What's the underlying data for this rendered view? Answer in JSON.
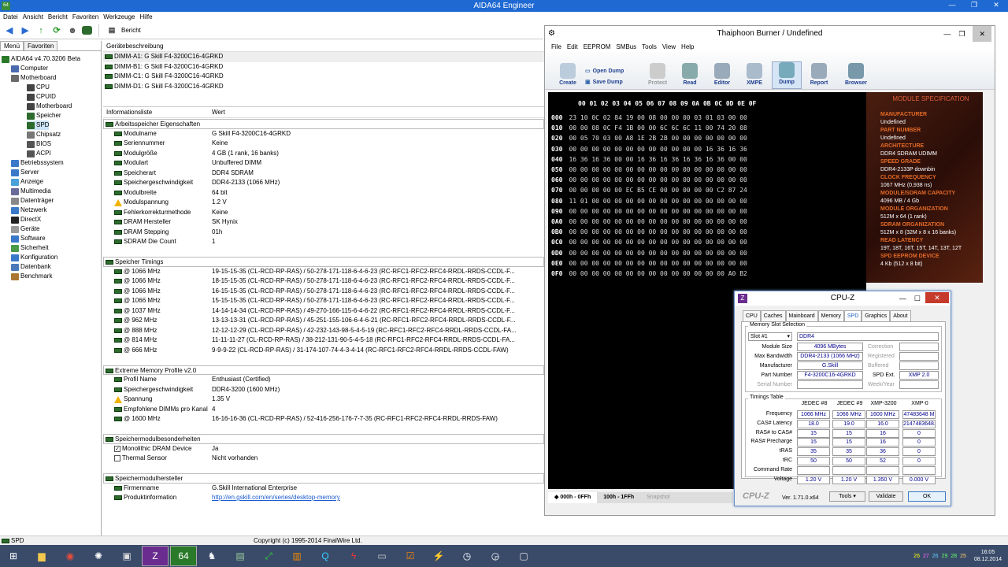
{
  "main_window": {
    "title": "AIDA64 Engineer",
    "menu": [
      "Datei",
      "Ansicht",
      "Bericht",
      "Favoriten",
      "Werkzeuge",
      "Hilfe"
    ],
    "toolbar_report_label": "Bericht"
  },
  "left_panel": {
    "tabs": [
      "Menü",
      "Favoriten"
    ],
    "tree": [
      {
        "label": "AIDA64 v4.70.3206 Beta",
        "indent": 0
      },
      {
        "label": "Computer",
        "indent": 1
      },
      {
        "label": "Motherboard",
        "indent": 1
      },
      {
        "label": "CPU",
        "indent": 2
      },
      {
        "label": "CPUID",
        "indent": 2
      },
      {
        "label": "Motherboard",
        "indent": 2
      },
      {
        "label": "Speicher",
        "indent": 2
      },
      {
        "label": "SPD",
        "indent": 2
      },
      {
        "label": "Chipsatz",
        "indent": 2
      },
      {
        "label": "BIOS",
        "indent": 2
      },
      {
        "label": "ACPI",
        "indent": 2
      },
      {
        "label": "Betriebssystem",
        "indent": 1
      },
      {
        "label": "Server",
        "indent": 1
      },
      {
        "label": "Anzeige",
        "indent": 1
      },
      {
        "label": "Multimedia",
        "indent": 1
      },
      {
        "label": "Datenträger",
        "indent": 1
      },
      {
        "label": "Netzwerk",
        "indent": 1
      },
      {
        "label": "DirectX",
        "indent": 1
      },
      {
        "label": "Geräte",
        "indent": 1
      },
      {
        "label": "Software",
        "indent": 1
      },
      {
        "label": "Sicherheit",
        "indent": 1
      },
      {
        "label": "Konfiguration",
        "indent": 1
      },
      {
        "label": "Datenbank",
        "indent": 1
      },
      {
        "label": "Benchmark",
        "indent": 1
      }
    ]
  },
  "device_pane": {
    "header": "Gerätebeschreibung",
    "rows": [
      "DIMM-A1: G Skill F4-3200C16-4GRKD",
      "DIMM-B1: G Skill F4-3200C16-4GRKD",
      "DIMM-C1: G Skill F4-3200C16-4GRKD",
      "DIMM-D1: G Skill F4-3200C16-4GRKD"
    ]
  },
  "info_pane": {
    "header_key": "Informationsliste",
    "header_value": "Wert",
    "rows": [
      {
        "type": "group",
        "k": "Arbeitsspeicher Eigenschaften",
        "v": ""
      },
      {
        "type": "item",
        "k": "Modulname",
        "v": "G Skill F4-3200C16-4GRKD"
      },
      {
        "type": "item",
        "k": "Seriennummer",
        "v": "Keine"
      },
      {
        "type": "item",
        "k": "Modulgröße",
        "v": "4 GB (1 rank, 16 banks)"
      },
      {
        "type": "item",
        "k": "Modulart",
        "v": "Unbuffered DIMM"
      },
      {
        "type": "item",
        "k": "Speicherart",
        "v": "DDR4 SDRAM"
      },
      {
        "type": "item",
        "k": "Speichergeschwindigkeit",
        "v": "DDR4-2133 (1066 MHz)"
      },
      {
        "type": "item",
        "k": "Modulbreite",
        "v": "64 bit"
      },
      {
        "type": "item",
        "k": "Modulspannung",
        "v": "1.2 V"
      },
      {
        "type": "item",
        "k": "Fehlerkorrekturmethode",
        "v": "Keine"
      },
      {
        "type": "item",
        "k": "DRAM Hersteller",
        "v": "SK Hynix"
      },
      {
        "type": "item",
        "k": "DRAM Stepping",
        "v": "01h"
      },
      {
        "type": "item",
        "k": "SDRAM Die Count",
        "v": "1"
      },
      {
        "type": "blank",
        "k": "",
        "v": ""
      },
      {
        "type": "group",
        "k": "Speicher Timings",
        "v": ""
      },
      {
        "type": "item",
        "k": "@ 1066 MHz",
        "v": "19-15-15-35  (CL-RCD-RP-RAS) / 50-278-171-118-6-4-6-23  (RC-RFC1-RFC2-RFC4-RRDL-RRDS-CCDL-F..."
      },
      {
        "type": "item",
        "k": "@ 1066 MHz",
        "v": "18-15-15-35  (CL-RCD-RP-RAS) / 50-278-171-118-6-4-6-23  (RC-RFC1-RFC2-RFC4-RRDL-RRDS-CCDL-F..."
      },
      {
        "type": "item",
        "k": "@ 1066 MHz",
        "v": "16-15-15-35  (CL-RCD-RP-RAS) / 50-278-171-118-6-4-6-23  (RC-RFC1-RFC2-RFC4-RRDL-RRDS-CCDL-F..."
      },
      {
        "type": "item",
        "k": "@ 1066 MHz",
        "v": "15-15-15-35  (CL-RCD-RP-RAS) / 50-278-171-118-6-4-6-23  (RC-RFC1-RFC2-RFC4-RRDL-RRDS-CCDL-F..."
      },
      {
        "type": "item",
        "k": "@ 1037 MHz",
        "v": "14-14-14-34  (CL-RCD-RP-RAS) / 49-270-166-115-6-4-6-22  (RC-RFC1-RFC2-RFC4-RRDL-RRDS-CCDL-F..."
      },
      {
        "type": "item",
        "k": "@ 962 MHz",
        "v": "13-13-13-31  (CL-RCD-RP-RAS) / 45-251-155-106-6-4-6-21  (RC-RFC1-RFC2-RFC4-RRDL-RRDS-CCDL-F..."
      },
      {
        "type": "item",
        "k": "@ 888 MHz",
        "v": "12-12-12-29  (CL-RCD-RP-RAS) / 42-232-143-98-5-4-5-19  (RC-RFC1-RFC2-RFC4-RRDL-RRDS-CCDL-FA..."
      },
      {
        "type": "item",
        "k": "@ 814 MHz",
        "v": "11-11-11-27  (CL-RCD-RP-RAS) / 38-212-131-90-5-4-5-18  (RC-RFC1-RFC2-RFC4-RRDL-RRDS-CCDL-FA..."
      },
      {
        "type": "item",
        "k": "@ 666 MHz",
        "v": "9-9-9-22  (CL-RCD-RP-RAS) / 31-174-107-74-4-3-4-14  (RC-RFC1-RFC2-RFC4-RRDL-RRDS-CCDL-FAW)"
      },
      {
        "type": "blank",
        "k": "",
        "v": ""
      },
      {
        "type": "group",
        "k": "Extreme Memory Profile v2.0",
        "v": ""
      },
      {
        "type": "item",
        "k": "Profil Name",
        "v": "Enthusiast (Certified)"
      },
      {
        "type": "item",
        "k": "Speichergeschwindigkeit",
        "v": "DDR4-3200 (1600 MHz)"
      },
      {
        "type": "item",
        "k": "Spannung",
        "v": "1.35 V"
      },
      {
        "type": "item",
        "k": "Empfohlene DIMMs pro Kanal",
        "v": "4"
      },
      {
        "type": "item",
        "k": "@ 1600 MHz",
        "v": "16-16-16-36  (CL-RCD-RP-RAS) / 52-416-256-176-7-7-35  (RC-RFC1-RFC2-RFC4-RRDL-RRDS-FAW)"
      },
      {
        "type": "blank",
        "k": "",
        "v": ""
      },
      {
        "type": "group",
        "k": "Speichermodulbesonderheiten",
        "v": ""
      },
      {
        "type": "check",
        "k": "Monolithic DRAM Device",
        "v": "Ja",
        "checked": true
      },
      {
        "type": "check",
        "k": "Thermal Sensor",
        "v": "Nicht vorhanden",
        "checked": false
      },
      {
        "type": "blank",
        "k": "",
        "v": ""
      },
      {
        "type": "group",
        "k": "Speichermodulhersteller",
        "v": ""
      },
      {
        "type": "item",
        "k": "Firmenname",
        "v": "G.Skill International Enterprise"
      },
      {
        "type": "link",
        "k": "Produktinformation",
        "v": "http://en.gskill.com/en/series/desktop-memory"
      }
    ]
  },
  "statusbar": {
    "left": "SPD",
    "center": "Copyright (c) 1995-2014 FinalWire Ltd."
  },
  "taskbar": {
    "time": "16:05",
    "date": "08.12.2014",
    "tray_numbers": [
      "26",
      "27",
      "26",
      "29",
      "28",
      "25"
    ]
  },
  "thaiphoon": {
    "title": "Thaiphoon Burner / Undefined",
    "menu": [
      "File",
      "Edit",
      "EEPROM",
      "SMBus",
      "Tools",
      "View",
      "Help"
    ],
    "toolbar": [
      "Create",
      "Open Dump",
      "Save Dump",
      "Protect",
      "Read",
      "Editor",
      "XMPE",
      "Dump",
      "Report",
      "Browser"
    ],
    "hex_header": "00 01 02 03 04 05 06 07 08 09 0A 0B 0C 0D 0E 0F",
    "hex_rows": [
      {
        "addr": "000",
        "bytes": "23 10 0C 02 84 19 00 08 00 00 00 03 01 03 00 00"
      },
      {
        "addr": "010",
        "bytes": "00 00 08 0C F4 1B 00 00 6C 6C 6C 11 00 74 20 08"
      },
      {
        "addr": "020",
        "bytes": "00 05 70 03 00 A8 1E 2B 2B 00 00 00 00 00 00 00"
      },
      {
        "addr": "030",
        "bytes": "00 00 00 00 00 00 00 00 00 00 00 00 16 36 16 36"
      },
      {
        "addr": "040",
        "bytes": "16 36 16 36 00 00 16 36 16 36 16 36 16 36 00 00"
      },
      {
        "addr": "050",
        "bytes": "00 00 00 00 00 00 00 00 00 00 00 00 00 00 00 00"
      },
      {
        "addr": "060",
        "bytes": "00 00 00 00 00 00 00 00 00 00 00 00 00 00 00 00"
      },
      {
        "addr": "070",
        "bytes": "00 00 00 00 00 EC B5 CE 00 00 00 00 00 C2 87 24"
      },
      {
        "addr": "080",
        "bytes": "11 01 00 00 00 00 00 00 00 00 00 00 00 00 00 00"
      },
      {
        "addr": "090",
        "bytes": "00 00 00 00 00 00 00 00 00 00 00 00 00 00 00 00"
      },
      {
        "addr": "0A0",
        "bytes": "00 00 00 00 00 00 00 00 00 00 00 00 00 00 00 00"
      },
      {
        "addr": "0B0",
        "bytes": "00 00 00 00 00 00 00 00 00 00 00 00 00 00 00 00"
      },
      {
        "addr": "0C0",
        "bytes": "00 00 00 00 00 00 00 00 00 00 00 00 00 00 00 00"
      },
      {
        "addr": "0D0",
        "bytes": "00 00 00 00 00 00 00 00 00 00 00 00 00 00 00 00"
      },
      {
        "addr": "0E0",
        "bytes": "00 00 00 00 00 00 00 00 00 00 00 00 00 00 00 00"
      },
      {
        "addr": "0F0",
        "bytes": "00 00 00 00 00 00 00 00 00 00 00 00 00 00 A0 B2"
      }
    ],
    "module_spec_title": "MODULE SPECIFICATION",
    "module_spec": [
      {
        "h": "MANUFACTURER",
        "v": "Undefined"
      },
      {
        "h": "PART NUMBER",
        "v": "Undefined"
      },
      {
        "h": "ARCHITECTURE",
        "v": "DDR4 SDRAM UDIMM"
      },
      {
        "h": "SPEED GRADE",
        "v": "DDR4-2133P downbin"
      },
      {
        "h": "CLOCK FREQUENCY",
        "v": "1067 MHz (0,938 ns)"
      },
      {
        "h": "MODULE/SDRAM CAPACITY",
        "v": "4096 MB / 4 Gb"
      },
      {
        "h": "MODULE ORGANIZATION",
        "v": "512M x 64 (1 rank)"
      },
      {
        "h": "SDRAM ORGANIZATION",
        "v": "512M x 8 (32M x 8 x 16 banks)"
      },
      {
        "h": "READ LATENCY",
        "v": "19T, 18T, 16T, 15T, 14T, 13T, 12T"
      },
      {
        "h": "SPD EEPROM DEVICE",
        "v": "4 Kb (512 x 8 bit)"
      }
    ],
    "bottom_tabs": [
      "000h - 0FFh",
      "100h - 1FFh",
      "Snapshot"
    ]
  },
  "cpuz": {
    "title": "CPU-Z",
    "tabs": [
      "CPU",
      "Caches",
      "Mainboard",
      "Memory",
      "SPD",
      "Graphics",
      "About"
    ],
    "slot_group": "Memory Slot Selection",
    "slot": "Slot #1",
    "type": "DDR4",
    "module_size_label": "Module Size",
    "module_size": "4096 MBytes",
    "max_bw_label": "Max Bandwidth",
    "max_bw": "DDR4-2133 (1066 MHz)",
    "manufacturer_label": "Manufacturer",
    "manufacturer": "G.Skill",
    "part_label": "Part Number",
    "part": "F4-3200C16-4GRKD",
    "serial_label": "Serial Number",
    "correction_label": "Correction",
    "registered_label": "Registered",
    "buffered_label": "Buffered",
    "spd_ext_label": "SPD Ext.",
    "spd_ext": "XMP 2.0",
    "week_label": "Week/Year",
    "timings_group": "Timings Table",
    "timing_cols": [
      "JEDEC #8",
      "JEDEC #9",
      "XMP-3200",
      "XMP-0"
    ],
    "timing_rows": [
      {
        "label": "Frequency",
        "vals": [
          "1066 MHz",
          "1066 MHz",
          "1600 MHz",
          "47483648 M"
        ]
      },
      {
        "label": "CAS# Latency",
        "vals": [
          "18.0",
          "19.0",
          "16.0",
          "2147483648."
        ]
      },
      {
        "label": "RAS# to CAS#",
        "vals": [
          "15",
          "15",
          "16",
          "0"
        ]
      },
      {
        "label": "RAS# Precharge",
        "vals": [
          "15",
          "15",
          "16",
          "0"
        ]
      },
      {
        "label": "tRAS",
        "vals": [
          "35",
          "35",
          "36",
          "0"
        ]
      },
      {
        "label": "tRC",
        "vals": [
          "50",
          "50",
          "52",
          "0"
        ]
      },
      {
        "label": "Command Rate",
        "vals": [
          "",
          "",
          "",
          ""
        ]
      },
      {
        "label": "Voltage",
        "vals": [
          "1.20 V",
          "1.20 V",
          "1.350 V",
          "0.000 V"
        ]
      }
    ],
    "version": "Ver. 1.71.0.x64",
    "tools": "Tools",
    "validate": "Validate",
    "ok": "OK"
  }
}
